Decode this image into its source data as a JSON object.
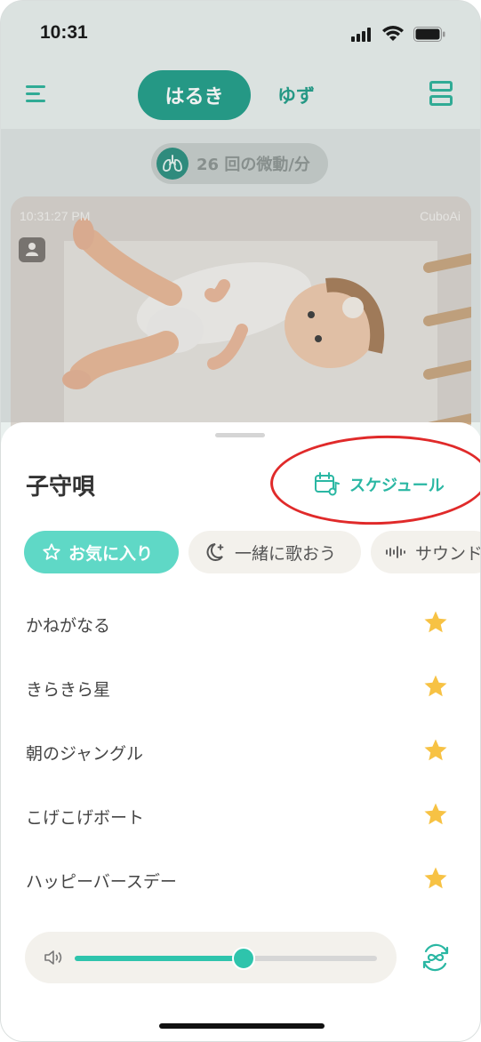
{
  "status_bar": {
    "time": "10:31"
  },
  "header": {
    "tabs": [
      {
        "label": "はるき",
        "active": true
      },
      {
        "label": "ゆず",
        "active": false
      }
    ]
  },
  "breathing": {
    "text": "26 回の微動/分"
  },
  "video": {
    "timestamp": "10:31:27 PM",
    "brand": "CuboAi"
  },
  "sheet": {
    "title": "子守唄",
    "schedule_label": "スケジュール",
    "chips": [
      {
        "label": "お気に入り",
        "icon": "star-outline-icon",
        "selected": true
      },
      {
        "label": "一緒に歌おう",
        "icon": "moon-stars-icon",
        "selected": false
      },
      {
        "label": "サウンド",
        "icon": "waveform-icon",
        "selected": false
      }
    ],
    "songs": [
      {
        "title": "かねがなる",
        "favorite": true
      },
      {
        "title": "きらきら星",
        "favorite": true
      },
      {
        "title": "朝のジャングル",
        "favorite": true
      },
      {
        "title": "こげこげボート",
        "favorite": true
      },
      {
        "title": "ハッピーバースデー",
        "favorite": true
      }
    ],
    "volume_level": 0.56
  },
  "colors": {
    "accent": "#1f9e88",
    "chip_selected": "#5fd8c6",
    "star": "#f7c244",
    "annotation": "#e02a2a"
  }
}
